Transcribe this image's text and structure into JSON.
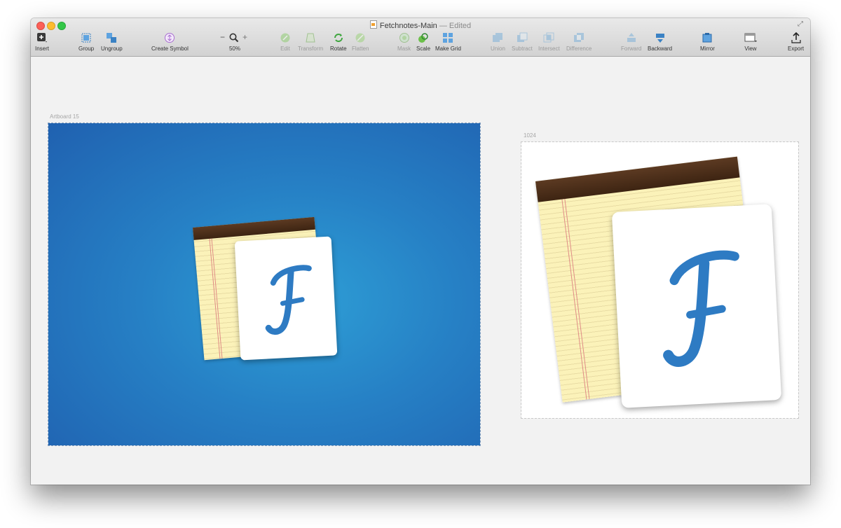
{
  "window": {
    "title": "Fetchnotes-Main",
    "title_suffix": "— Edited"
  },
  "toolbar": {
    "insert": "Insert",
    "group": "Group",
    "ungroup": "Ungroup",
    "create_symbol": "Create Symbol",
    "zoom_minus": "−",
    "zoom_plus": "+",
    "zoom_level": "50%",
    "edit": "Edit",
    "transform": "Transform",
    "rotate": "Rotate",
    "flatten": "Flatten",
    "mask": "Mask",
    "scale": "Scale",
    "make_grid": "Make Grid",
    "union": "Union",
    "subtract": "Subtract",
    "intersect": "Intersect",
    "difference": "Difference",
    "forward": "Forward",
    "backward": "Backward",
    "mirror": "Mirror",
    "view": "View",
    "export": "Export"
  },
  "canvas": {
    "artboard1_label": "Artboard 15",
    "artboard2_label": "1024"
  },
  "colors": {
    "artboard_blue": "#2680c5",
    "icon_f_blue": "#2e7bc3",
    "pad_yellow": "#fbf2b9",
    "pad_leather": "#4a2c18"
  }
}
